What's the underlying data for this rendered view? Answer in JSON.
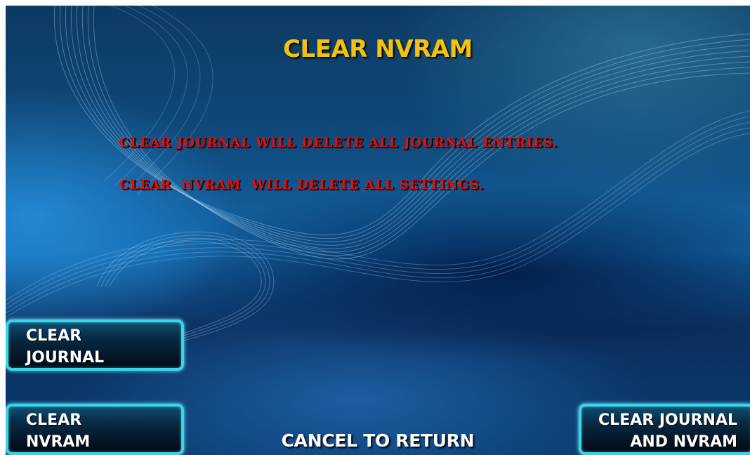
{
  "screen": {
    "title": "CLEAR NVRAM",
    "messages": [
      "CLEAR JOURNAL WILL DELETE ALL JOURNAL ENTRIES.",
      "CLEAR  NVRAM  WILL DELETE ALL SETTINGS."
    ],
    "footer": "CANCEL TO RETURN"
  },
  "softkeys": {
    "clear_journal": {
      "line1": "CLEAR",
      "line2": "JOURNAL"
    },
    "clear_nvram": {
      "line1": "CLEAR",
      "line2": "NVRAM"
    },
    "clear_journal_and_nvram": {
      "line1": "CLEAR JOURNAL",
      "line2": "AND NVRAM"
    }
  },
  "colors": {
    "title": "#f4c20d",
    "message": "#e01010",
    "button_border": "#35d7e9",
    "background": "#0f4a7c"
  }
}
